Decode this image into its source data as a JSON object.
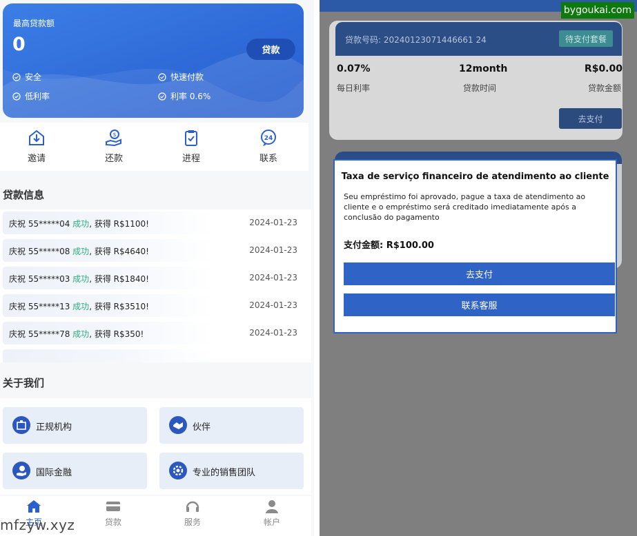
{
  "left": {
    "hero": {
      "label": "最高贷款额",
      "amount": "0",
      "button": "贷款",
      "features": [
        "安全",
        "快速付款",
        "低利率",
        "利率 0.6%"
      ]
    },
    "quick_actions": [
      {
        "label": "邀请",
        "icon": "download-box-icon"
      },
      {
        "label": "还款",
        "icon": "money-hand-icon"
      },
      {
        "label": "进程",
        "icon": "clipboard-check-icon"
      },
      {
        "label": "联系",
        "icon": "24h-support-icon"
      }
    ],
    "loan_info_title": "贷款信息",
    "news": [
      {
        "prefix": "庆祝 55*****04 ",
        "status": "成功",
        "suffix": ", 获得 R$1100!",
        "date": "2024-01-23"
      },
      {
        "prefix": "庆祝 55*****08 ",
        "status": "成功",
        "suffix": ", 获得 R$4640!",
        "date": "2024-01-23"
      },
      {
        "prefix": "庆祝 55*****03 ",
        "status": "成功",
        "suffix": ", 获得 R$1840!",
        "date": "2024-01-23"
      },
      {
        "prefix": "庆祝 55*****13 ",
        "status": "成功",
        "suffix": ", 获得 R$3510!",
        "date": "2024-01-23"
      },
      {
        "prefix": "庆祝 55*****78 ",
        "status": "成功",
        "suffix": ", 获得 R$350!",
        "date": "2024-01-23"
      }
    ],
    "about_title": "关于我们",
    "about_cards": [
      {
        "label": "正规机构",
        "icon": "institution-icon"
      },
      {
        "label": "伙伴",
        "icon": "handshake-icon"
      },
      {
        "label": "国际金融",
        "icon": "finance-hand-icon"
      },
      {
        "label": "专业的销售团队",
        "icon": "team-gear-icon"
      }
    ],
    "tabs": [
      {
        "label": "主页",
        "icon": "home-icon",
        "active": true
      },
      {
        "label": "贷款",
        "icon": "card-icon",
        "active": false
      },
      {
        "label": "服务",
        "icon": "headset-icon",
        "active": false
      },
      {
        "label": "帐户",
        "icon": "user-icon",
        "active": false
      }
    ],
    "watermark": "mfzyw.xyz"
  },
  "right": {
    "watermark": "bygoukai.com",
    "order": {
      "number": "贷款号码: 20240123071446661 24",
      "status_button": "待支付套餐",
      "daily_rate": "0.07%",
      "daily_rate_label": "每日利率",
      "term": "12month",
      "term_label": "贷款时间",
      "amount": "R$0.00",
      "amount_label": "贷款金额",
      "pay_button": "去支付"
    },
    "modal": {
      "title": "Taxa de serviço financeiro de atendimento ao cliente",
      "body": "Seu empréstimo foi aprovado, pague a taxa de atendimento ao cliente e o empréstimo será creditado imediatamente após a conclusão do pagamento",
      "amount": "支付金额: R$100.00",
      "pay_button": "去支付",
      "contact_button": "联系客服"
    }
  }
}
